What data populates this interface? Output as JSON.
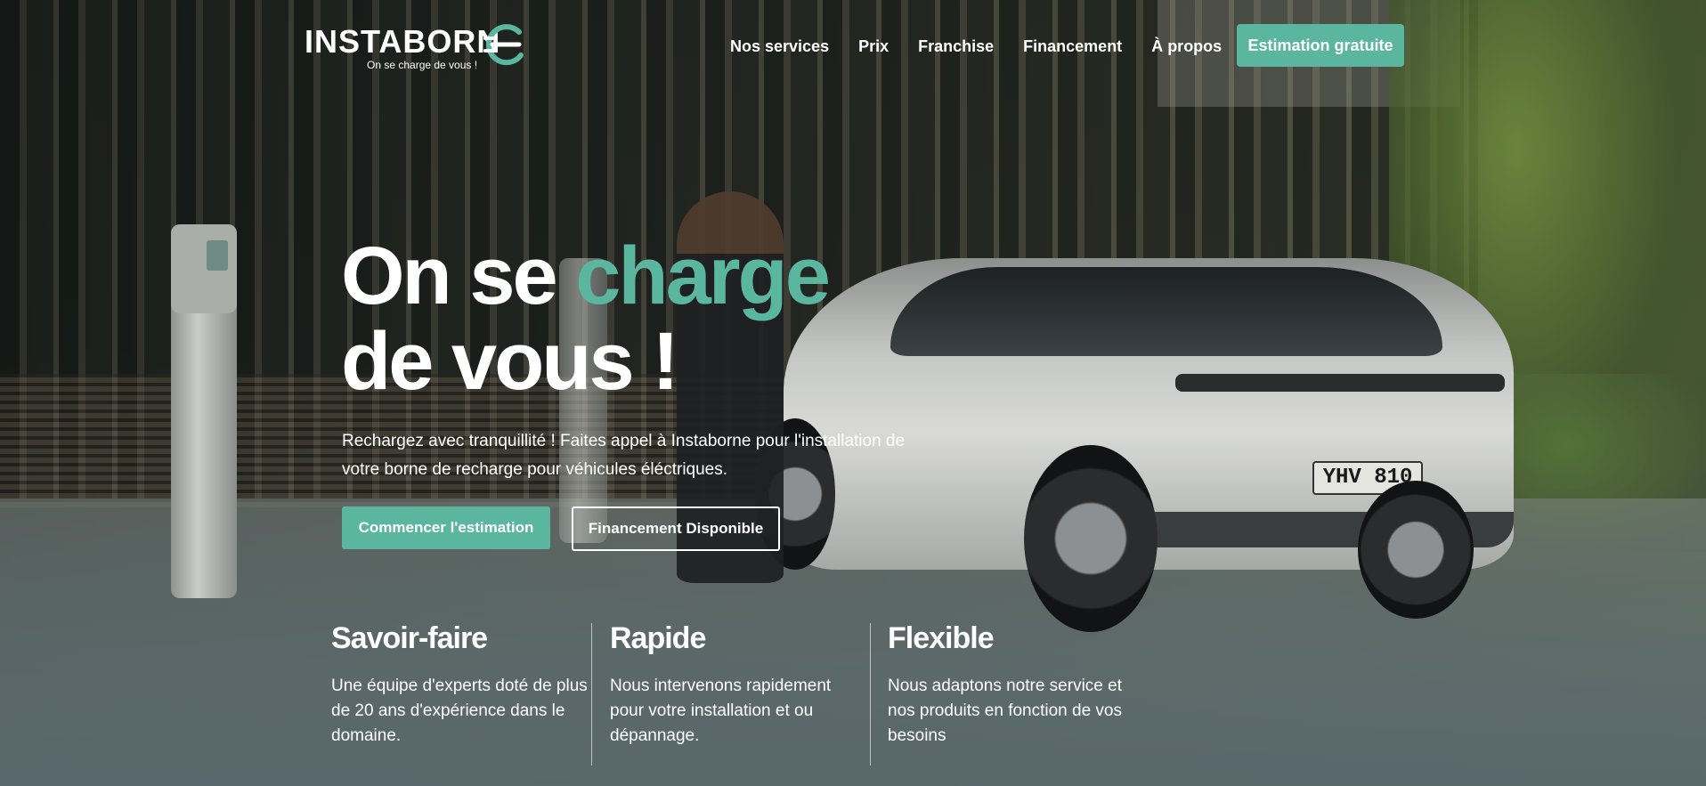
{
  "brand": {
    "name": "INSTABORN",
    "tagline": "On se charge de vous !",
    "accent_color": "#5bb6a0",
    "logo_icon": "plug-e-icon"
  },
  "nav": {
    "items": [
      {
        "label": "Nos services"
      },
      {
        "label": "Prix"
      },
      {
        "label": "Franchise"
      },
      {
        "label": "Financement"
      },
      {
        "label": "À propos"
      }
    ],
    "cta_label": "Estimation gratuite"
  },
  "hero": {
    "headline_part1": "On se ",
    "headline_accent": "charge",
    "headline_part2": "de vous !",
    "lead": "Rechargez avec tranquillité ! Faites appel à Instaborne pour l'installation de votre borne de recharge pour véhicules éléctriques.",
    "primary_button": "Commencer l'estimation",
    "secondary_button": "Financement Disponible",
    "plate_text": "YHV 810"
  },
  "features": [
    {
      "title": "Savoir-faire",
      "text": "Une équipe d'experts doté de plus de 20 ans d'expérience dans le domaine."
    },
    {
      "title": "Rapide",
      "text": "Nous intervenons rapidement pour votre installation et ou dépannage."
    },
    {
      "title": "Flexible",
      "text": "Nous adaptons notre service et nos produits en fonction de vos besoins"
    }
  ]
}
